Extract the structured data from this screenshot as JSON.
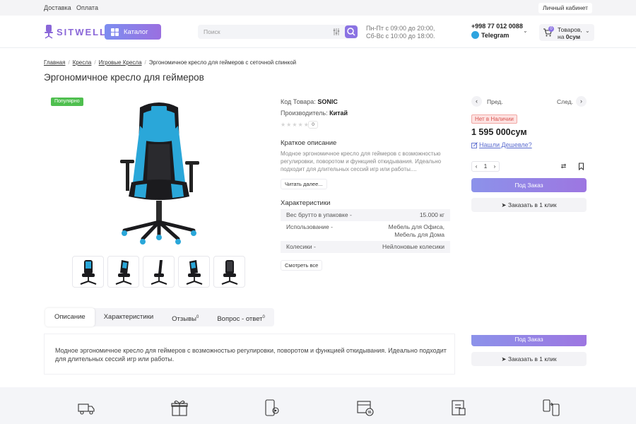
{
  "topbar": {
    "links": [
      "Доставка",
      "Оплата"
    ],
    "cabinet": "Личный кабинет"
  },
  "header": {
    "logo": "SITWELL",
    "catalog": "Каталог",
    "search_placeholder": "Поиск",
    "hours_line1": "Пн-Пт с 09:00 до 20:00,",
    "hours_line2": "Сб-Вс с 10:00 до 18:00.",
    "phone": "+998 77 012 0088",
    "telegram": "Telegram",
    "cart_count": "0",
    "cart_line1": "Товаров,",
    "cart_line2_prefix": "на",
    "cart_sum": "0сум"
  },
  "breadcrumbs": [
    "Главная",
    "Кресла",
    "Игровые Кресла",
    "Эргономичное кресло для геймеров с сеточной спинкой"
  ],
  "product": {
    "title": "Эргономичное кресло для геймеров",
    "badge": "Популярно",
    "code_label": "Код Товара:",
    "code": "SONIC",
    "maker_label": "Производитель:",
    "maker": "Китай",
    "review_count": "0",
    "short_desc_title": "Краткое описание",
    "short_desc": "Модное эргономичное кресло для геймеров с возможностью регулировки, поворотом и функцией откидывания. Идеально подходит для длительных сессий игр или работы....",
    "read_more": "Читать далее...",
    "chars_title": "Характеристики",
    "chars": [
      {
        "k": "Вес брутто в упаковке -",
        "v": "15.000 кг"
      },
      {
        "k": "Использование -",
        "v": "Мебель для Офиса, Мебель для Дома"
      },
      {
        "k": "Колесики -",
        "v": "Нейлоновые колесики"
      }
    ],
    "see_all": "Смотреть все"
  },
  "buy": {
    "prev": "Пред.",
    "next": "След.",
    "stock": "Нет в Наличии",
    "price": "1 595 000сум",
    "cheaper": "Нашли Дешевле?",
    "qty": "1",
    "order": "Под Заказ",
    "oneclick": "Заказать в 1 клик"
  },
  "tabs": [
    {
      "label": "Описание",
      "count": ""
    },
    {
      "label": "Характеристики",
      "count": ""
    },
    {
      "label": "Отзывы",
      "count": "0"
    },
    {
      "label": "Вопрос - ответ",
      "count": "0"
    }
  ],
  "description": "Модное эргономичное кресло для геймеров с возможностью регулировки, поворотом и функцией откидывания. Идеально подходит для длительных сессий игр или работы.",
  "colors": {
    "accent": "#8b73e3",
    "chair_blue": "#2aa7d9",
    "badge_green": "#4fbf4f",
    "stock_red": "#d9534f"
  },
  "footer_icons": [
    "delivery-truck-icon",
    "gift-box-icon",
    "phone-settings-icon",
    "box-exchange-icon",
    "document-icon",
    "phone-transfer-icon"
  ]
}
